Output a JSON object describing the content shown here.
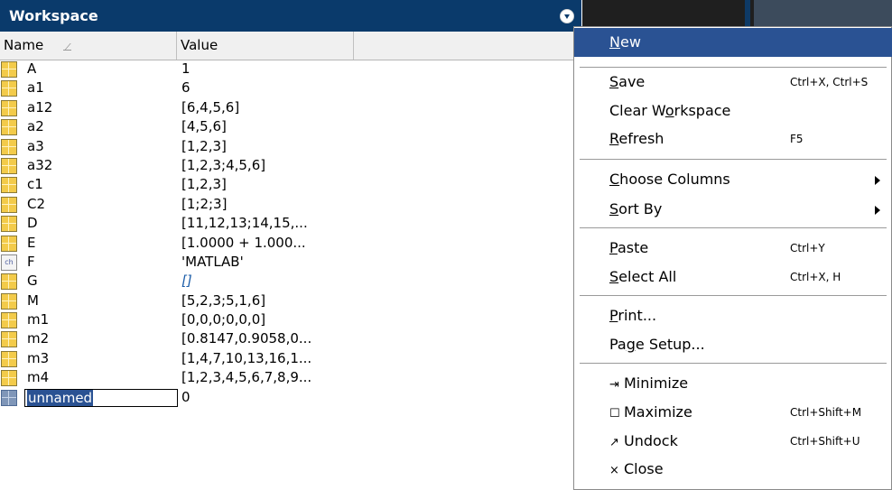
{
  "panel": {
    "title": "Workspace",
    "columns": {
      "name": "Name",
      "value": "Value"
    }
  },
  "variables": [
    {
      "name": "A",
      "value": "1",
      "icon": "matrix-icon"
    },
    {
      "name": "a1",
      "value": "6",
      "icon": "matrix-icon"
    },
    {
      "name": "a12",
      "value": "[6,4,5,6]",
      "icon": "matrix-icon"
    },
    {
      "name": "a2",
      "value": "[4,5,6]",
      "icon": "matrix-icon"
    },
    {
      "name": "a3",
      "value": "[1,2,3]",
      "icon": "matrix-icon"
    },
    {
      "name": "a32",
      "value": "[1,2,3;4,5,6]",
      "icon": "matrix-icon"
    },
    {
      "name": "c1",
      "value": "[1,2,3]",
      "icon": "matrix-icon"
    },
    {
      "name": "C2",
      "value": "[1;2;3]",
      "icon": "matrix-icon"
    },
    {
      "name": "D",
      "value": "[11,12,13;14,15,...",
      "icon": "matrix-icon"
    },
    {
      "name": "E",
      "value": "[1.0000 + 1.000...",
      "icon": "matrix-icon"
    },
    {
      "name": "F",
      "value": "'MATLAB'",
      "icon": "char-icon",
      "icon_text": "ch"
    },
    {
      "name": "G",
      "value": "[]",
      "icon": "matrix-icon"
    },
    {
      "name": "M",
      "value": "[5,2,3;5,1,6]",
      "icon": "matrix-icon"
    },
    {
      "name": "m1",
      "value": "[0,0,0;0,0,0]",
      "icon": "matrix-icon"
    },
    {
      "name": "m2",
      "value": "[0.8147,0.9058,0...",
      "icon": "matrix-icon"
    },
    {
      "name": "m3",
      "value": "[1,4,7,10,13,16,1...",
      "icon": "matrix-icon"
    },
    {
      "name": "m4",
      "value": "[1,2,3,4,5,6,7,8,9...",
      "icon": "matrix-icon"
    }
  ],
  "new_variable": {
    "name": "unnamed",
    "value": "0"
  },
  "context_menu": {
    "new": {
      "pre": "",
      "key": "N",
      "post": "ew"
    },
    "save": {
      "pre": "",
      "key": "S",
      "post": "ave",
      "shortcut": "Ctrl+X, Ctrl+S"
    },
    "clear": {
      "pre": "Clear W",
      "key": "o",
      "post": "rkspace"
    },
    "refresh": {
      "pre": "",
      "key": "R",
      "post": "efresh",
      "shortcut": "F5"
    },
    "choose_columns": {
      "pre": "",
      "key": "C",
      "post": "hoose Columns"
    },
    "sort_by": {
      "pre": "",
      "key": "S",
      "post": "ort By"
    },
    "paste": {
      "pre": "",
      "key": "P",
      "post": "aste",
      "shortcut": "Ctrl+Y"
    },
    "select_all": {
      "pre": "",
      "key": "S",
      "post": "elect All",
      "shortcut": "Ctrl+X, H"
    },
    "print": {
      "pre": "",
      "key": "P",
      "post": "rint..."
    },
    "page_setup": {
      "pre": "Pa",
      "key": "g",
      "post": "e Setup..."
    },
    "minimize": {
      "glyph": "⇥",
      "label": "Minimize"
    },
    "maximize": {
      "glyph": "☐",
      "label": "Maximize",
      "shortcut": "Ctrl+Shift+M"
    },
    "undock": {
      "glyph": "↗",
      "label": "Undock",
      "shortcut": "Ctrl+Shift+U"
    },
    "close": {
      "glyph": "×",
      "label": "Close"
    }
  },
  "colors": {
    "title_bar": "#0a3a6b",
    "highlight": "#2a5293",
    "matrix_icon": "#f3cb4a"
  }
}
